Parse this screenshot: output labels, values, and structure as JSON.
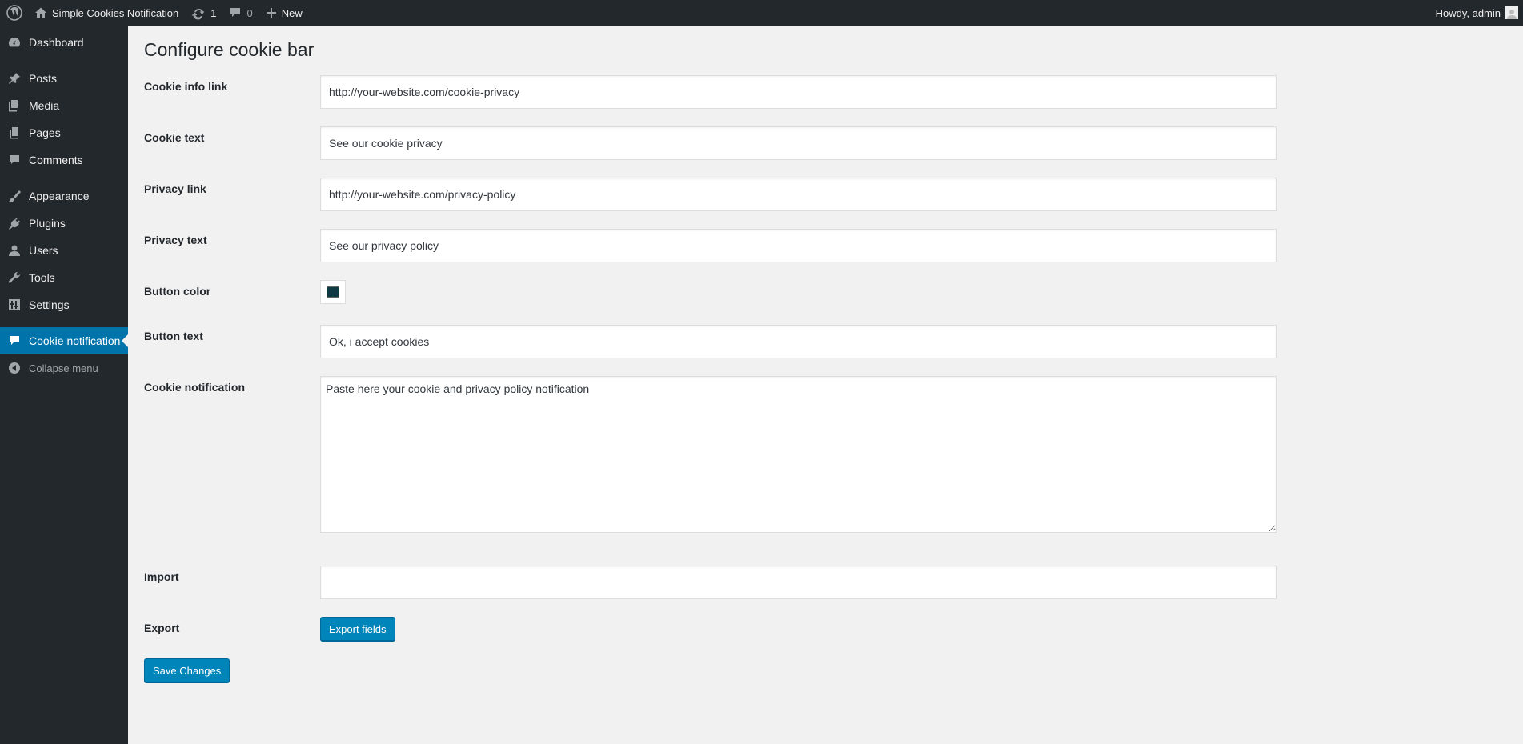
{
  "adminbar": {
    "site_name": "Simple Cookies Notification",
    "updates_count": "1",
    "comments_count": "0",
    "new_label": "New",
    "howdy": "Howdy, admin"
  },
  "sidebar": {
    "items": [
      {
        "label": "Dashboard",
        "icon": "dashboard-icon"
      },
      {
        "label": "Posts",
        "icon": "pin-icon"
      },
      {
        "label": "Media",
        "icon": "media-icon"
      },
      {
        "label": "Pages",
        "icon": "pages-icon"
      },
      {
        "label": "Comments",
        "icon": "comment-icon"
      },
      {
        "label": "Appearance",
        "icon": "brush-icon"
      },
      {
        "label": "Plugins",
        "icon": "plug-icon"
      },
      {
        "label": "Users",
        "icon": "user-icon"
      },
      {
        "label": "Tools",
        "icon": "wrench-icon"
      },
      {
        "label": "Settings",
        "icon": "settings-icon"
      },
      {
        "label": "Cookie notification",
        "icon": "comment-icon",
        "current": true
      },
      {
        "label": "Collapse menu",
        "icon": "collapse-icon"
      }
    ]
  },
  "page": {
    "title": "Configure cookie bar"
  },
  "form": {
    "cookie_info_link": {
      "label": "Cookie info link",
      "value": "http://your-website.com/cookie-privacy"
    },
    "cookie_text": {
      "label": "Cookie text",
      "value": "See our cookie privacy"
    },
    "privacy_link": {
      "label": "Privacy link",
      "value": "http://your-website.com/privacy-policy"
    },
    "privacy_text": {
      "label": "Privacy text",
      "value": "See our privacy policy"
    },
    "button_color": {
      "label": "Button color",
      "value": "#0e3a44"
    },
    "button_text": {
      "label": "Button text",
      "value": "Ok, i accept cookies"
    },
    "cookie_notification": {
      "label": "Cookie notification",
      "value": "Paste here your cookie and privacy policy notification"
    },
    "import": {
      "label": "Import",
      "value": ""
    },
    "export": {
      "label": "Export",
      "button": "Export fields"
    },
    "save_label": "Save Changes"
  },
  "colors": {
    "adminbar_bg": "#23282d",
    "accent": "#0073aa",
    "button_primary": "#0085ba"
  }
}
